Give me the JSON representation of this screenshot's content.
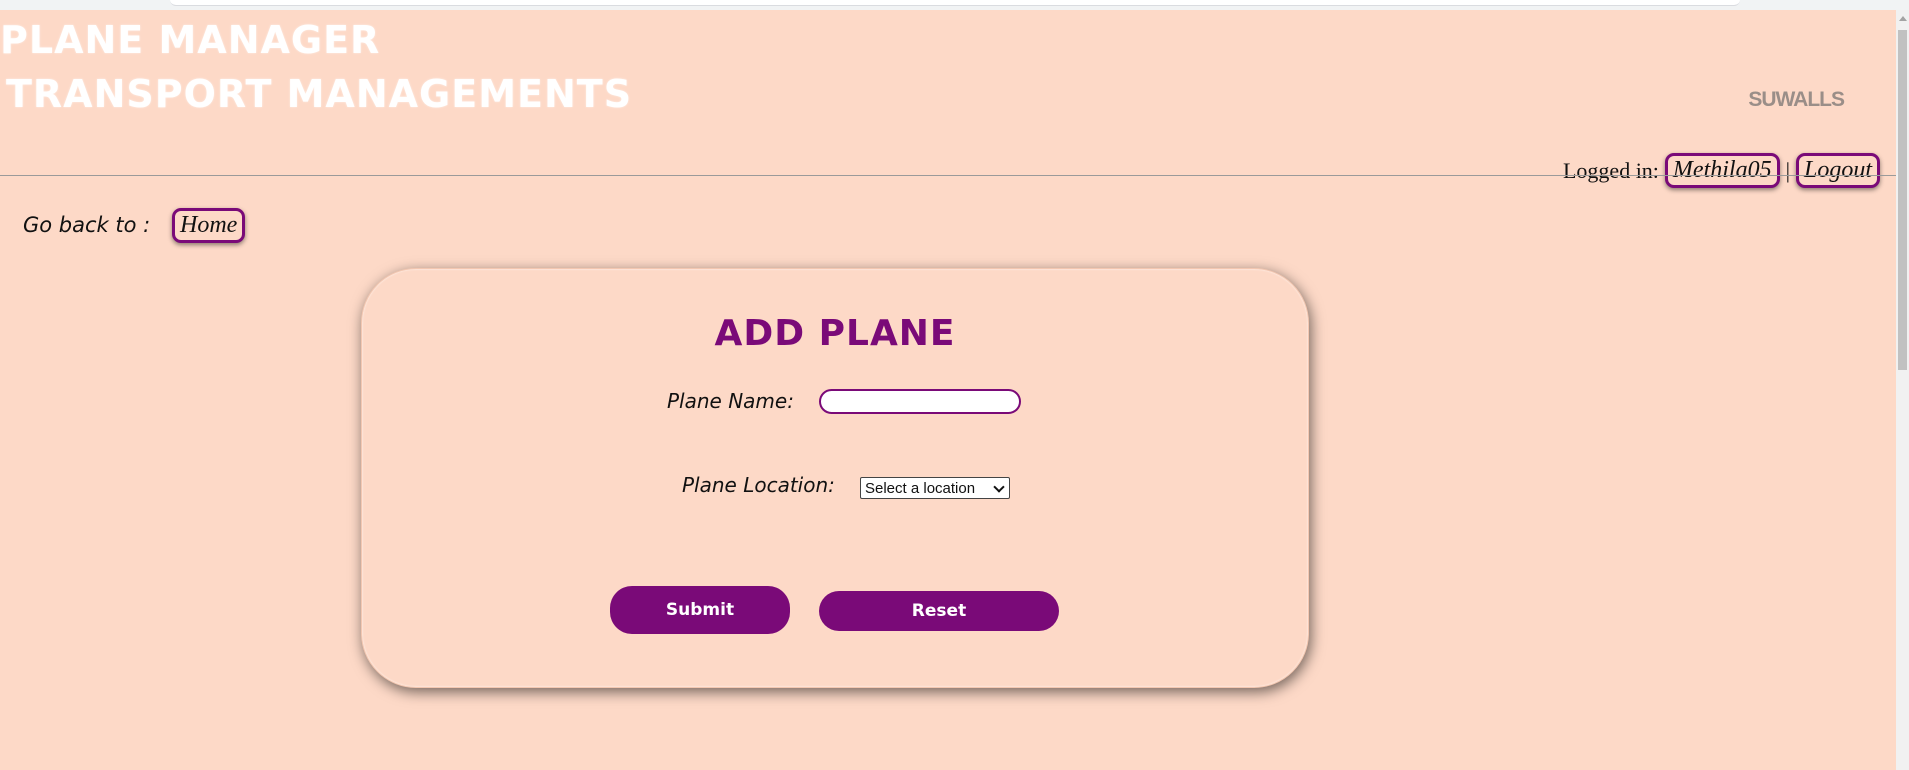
{
  "header": {
    "brand_line1": "PLANE MANAGER",
    "brand_line2": "TRANSPORT MANAGEMENTS",
    "right_logo": "SUWALLS"
  },
  "user_bar": {
    "logged_in_label": "Logged in:",
    "username": "Methila05",
    "separator": "|",
    "logout_label": "Logout"
  },
  "nav": {
    "back_label": "Go back to :",
    "home_label": "Home"
  },
  "form": {
    "title": "ADD PLANE",
    "plane_name_label": "Plane Name:",
    "plane_name_value": "",
    "plane_location_label": "Plane Location:",
    "plane_location_selected": "Select a location",
    "submit_label": "Submit",
    "reset_label": "Reset"
  },
  "colors": {
    "page_background": "#fdd9c7",
    "accent": "#7a0a78",
    "brand_text": "#ffffff"
  }
}
